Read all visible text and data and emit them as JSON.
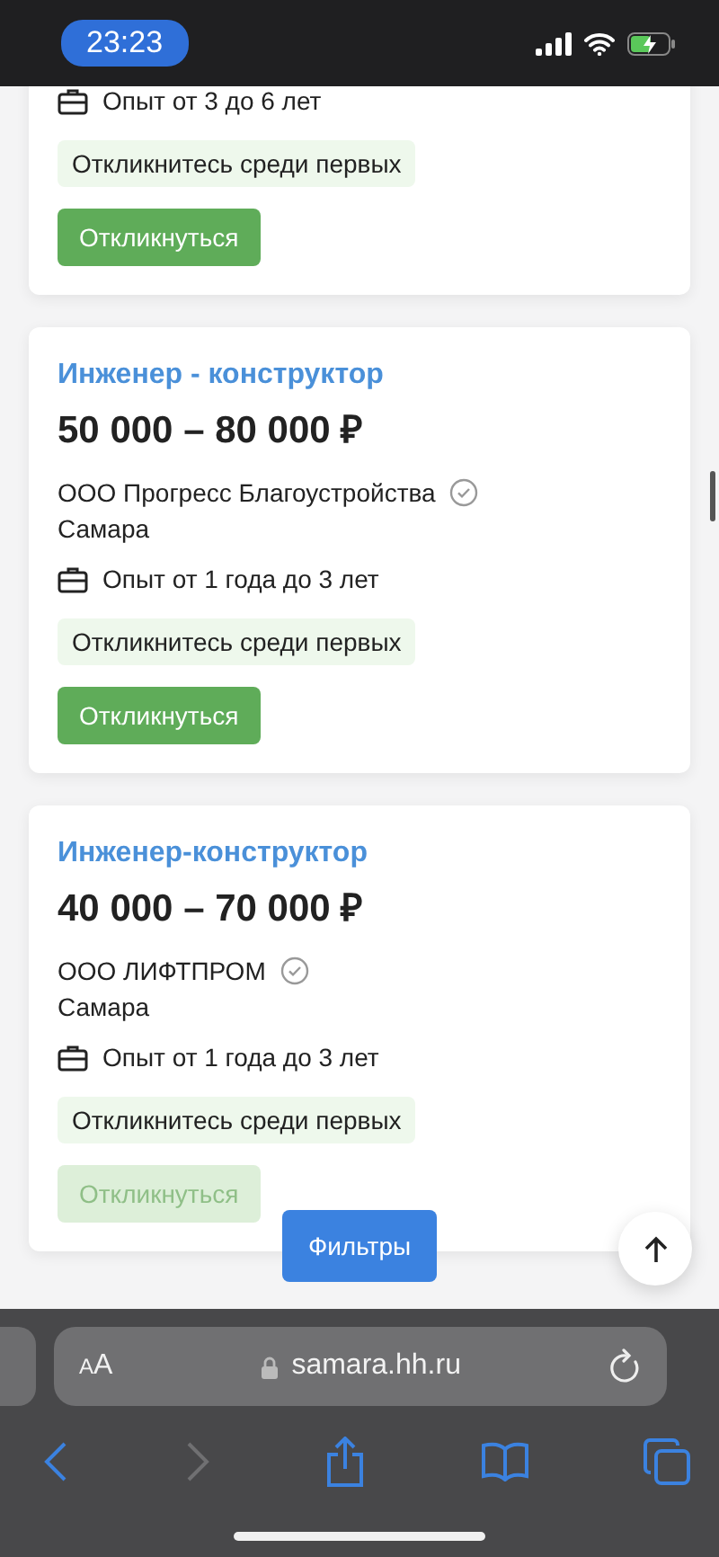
{
  "status_bar": {
    "time": "23:23"
  },
  "vacancies": [
    {
      "experience": "Опыт от 3 до 6 лет",
      "badge": "Откликнитесь среди первых",
      "button": {
        "label": "Откликнуться",
        "disabled": false
      }
    },
    {
      "title": "Инженер - конструктор",
      "salary": "50 000 – 80 000 ₽",
      "company": "ООО Прогресс Благоустройства",
      "city": "Самара",
      "experience": "Опыт от 1 года до 3 лет",
      "badge": "Откликнитесь среди первых",
      "button": {
        "label": "Откликнуться",
        "disabled": false
      }
    },
    {
      "title": "Инженер-конструктор",
      "salary": "40 000 – 70 000 ₽",
      "company": "ООО ЛИФТПРОМ",
      "city": "Самара",
      "experience": "Опыт от 1 года до 3 лет",
      "badge": "Откликнитесь среди первых",
      "button": {
        "label": "Откликнуться",
        "disabled": true
      }
    }
  ],
  "filters_button": "Фильтры",
  "browser": {
    "text_size_button": "AA",
    "url": "samara.hh.ru",
    "back_enabled": true,
    "forward_enabled": false
  }
}
